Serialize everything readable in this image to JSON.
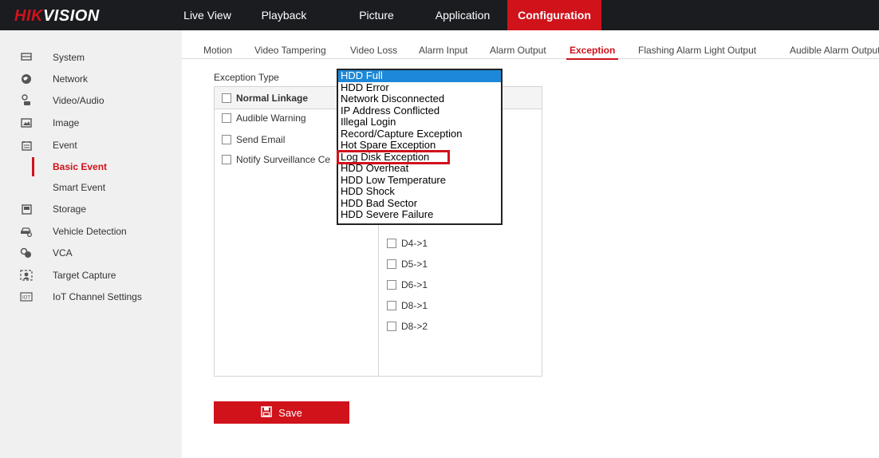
{
  "brand": {
    "part1": "HIK",
    "part2": "VISION"
  },
  "topnav": [
    {
      "label": "Live View"
    },
    {
      "label": "Playback"
    },
    {
      "label": "Picture"
    },
    {
      "label": "Application"
    },
    {
      "label": "Configuration"
    }
  ],
  "sidebar": [
    {
      "label": "System",
      "icon": "monitor-icon"
    },
    {
      "label": "Network",
      "icon": "globe-icon"
    },
    {
      "label": "Video/Audio",
      "icon": "video-audio-icon"
    },
    {
      "label": "Image",
      "icon": "image-icon"
    },
    {
      "label": "Event",
      "icon": "calendar-icon"
    },
    {
      "label": "Basic Event"
    },
    {
      "label": "Smart Event"
    },
    {
      "label": "Storage",
      "icon": "storage-icon"
    },
    {
      "label": "Vehicle Detection",
      "icon": "vehicle-icon"
    },
    {
      "label": "VCA",
      "icon": "vca-icon"
    },
    {
      "label": "Target Capture",
      "icon": "target-capture-icon"
    },
    {
      "label": "IoT Channel Settings",
      "icon": "iot-icon"
    }
  ],
  "subtabs": [
    {
      "label": "Motion"
    },
    {
      "label": "Video Tampering"
    },
    {
      "label": "Video Loss"
    },
    {
      "label": "Alarm Input"
    },
    {
      "label": "Alarm Output"
    },
    {
      "label": "Exception"
    },
    {
      "label": "Flashing Alarm Light Output"
    },
    {
      "label": "Audible Alarm Output"
    }
  ],
  "exception": {
    "type_label": "Exception Type",
    "selected": "HDD Full",
    "options": [
      "HDD Full",
      "HDD Error",
      "Network Disconnected",
      "IP Address Conflicted",
      "Illegal Login",
      "Record/Capture Exception",
      "Hot Spare Exception",
      "Log Disk Exception",
      "HDD Overheat",
      "HDD Low Temperature",
      "HDD Shock",
      "HDD Bad Sector",
      "HDD Severe Failure"
    ]
  },
  "linkage": {
    "header": "Normal Linkage",
    "items": [
      "Audible Warning",
      "Send Email",
      "Notify Surveillance Ce"
    ]
  },
  "outputs": [
    "D4->1",
    "D5->1",
    "D6->1",
    "D8->1",
    "D8->2"
  ],
  "save_label": "Save",
  "colors": {
    "accent": "#d0121b",
    "topbar": "#1a1c20",
    "selection": "#1e88d8",
    "sidebar_bg": "#f0f0f0"
  }
}
